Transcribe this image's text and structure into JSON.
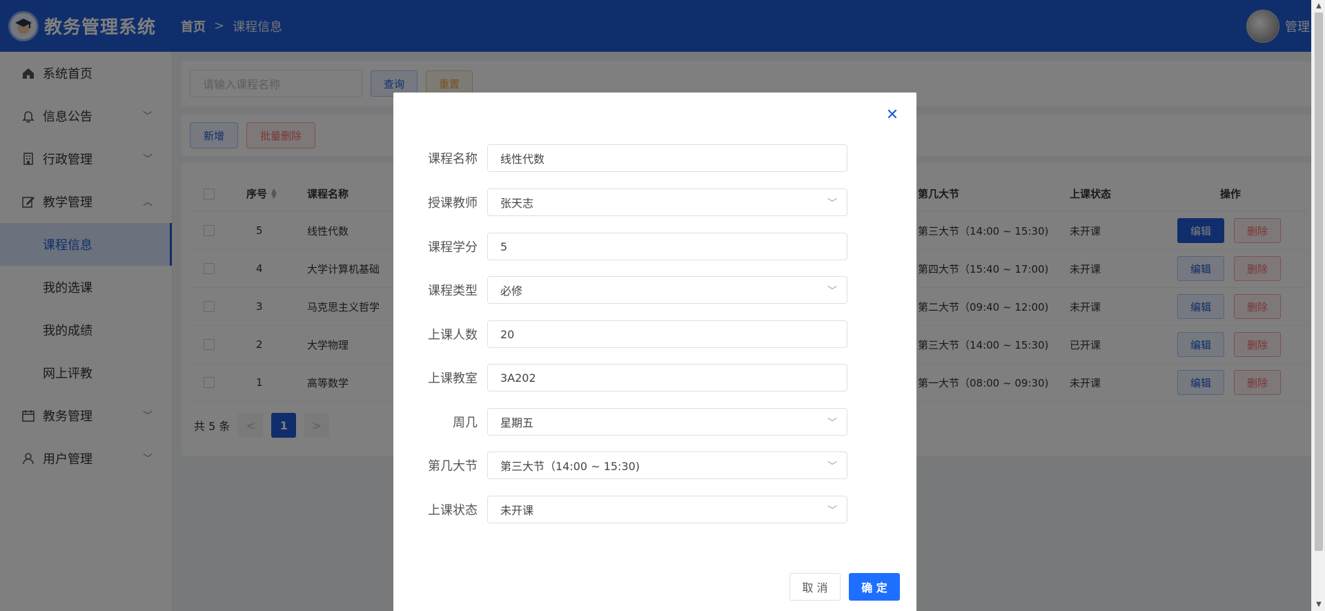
{
  "app": {
    "title": "教务管理系统",
    "logo_icon": "graduate-logo-icon"
  },
  "breadcrumb": {
    "home": "首页",
    "separator": ">",
    "current": "课程信息"
  },
  "user": {
    "name": "管理员"
  },
  "sidebar": {
    "items": [
      {
        "label": "系统首页",
        "icon": "home-icon"
      },
      {
        "label": "信息公告",
        "icon": "bell-icon"
      },
      {
        "label": "行政管理",
        "icon": "building-icon"
      },
      {
        "label": "教学管理",
        "icon": "edit-icon"
      },
      {
        "label": "教务管理",
        "icon": "calendar-icon"
      },
      {
        "label": "用户管理",
        "icon": "user-icon"
      }
    ],
    "subitems": [
      "课程信息",
      "我的选课",
      "我的成绩",
      "网上评教"
    ]
  },
  "search": {
    "placeholder": "请输入课程名称",
    "query_label": "查询",
    "reset_label": "重置"
  },
  "actions": {
    "add_label": "新增",
    "batch_delete_label": "批量删除"
  },
  "table": {
    "headers": {
      "index": "序号",
      "name": "课程名称",
      "section": "第几大节",
      "status": "上课状态",
      "ops": "操作"
    },
    "rows": [
      {
        "index": "5",
        "name": "线性代数",
        "section": "第三大节（14:00 ~ 15:30)",
        "status": "未开课"
      },
      {
        "index": "4",
        "name": "大学计算机基础",
        "section": "第四大节（15:40 ~ 17:00)",
        "status": "未开课"
      },
      {
        "index": "3",
        "name": "马克思主义哲学",
        "section": "第二大节（09:40 ~ 12:00)",
        "status": "未开课"
      },
      {
        "index": "2",
        "name": "大学物理",
        "section": "第三大节（14:00 ~ 15:30)",
        "status": "已开课"
      },
      {
        "index": "1",
        "name": "高等数学",
        "section": "第一大节（08:00 ~ 09:30)",
        "status": "未开课"
      }
    ],
    "edit_label": "编辑",
    "delete_label": "删除"
  },
  "pager": {
    "total": "共 5 条",
    "prev": "<",
    "current": "1",
    "next": ">"
  },
  "dialog": {
    "fields": [
      {
        "label": "课程名称",
        "value": "线性代数"
      },
      {
        "label": "授课教师",
        "value": "张天志"
      },
      {
        "label": "课程学分",
        "value": "5"
      },
      {
        "label": "课程类型",
        "value": "必修"
      },
      {
        "label": "上课人数",
        "value": "20"
      },
      {
        "label": "上课教室",
        "value": "3A202"
      },
      {
        "label": "周几",
        "value": "星期五"
      },
      {
        "label": "第几大节",
        "value": "第三大节（14:00 ~ 15:30)"
      },
      {
        "label": "上课状态",
        "value": "未开课"
      }
    ],
    "cancel_label": "取 消",
    "confirm_label": "确 定"
  },
  "colors": {
    "primary": "#1e5cd7",
    "danger": "#f56c6c",
    "warning": "#e6a23c"
  }
}
